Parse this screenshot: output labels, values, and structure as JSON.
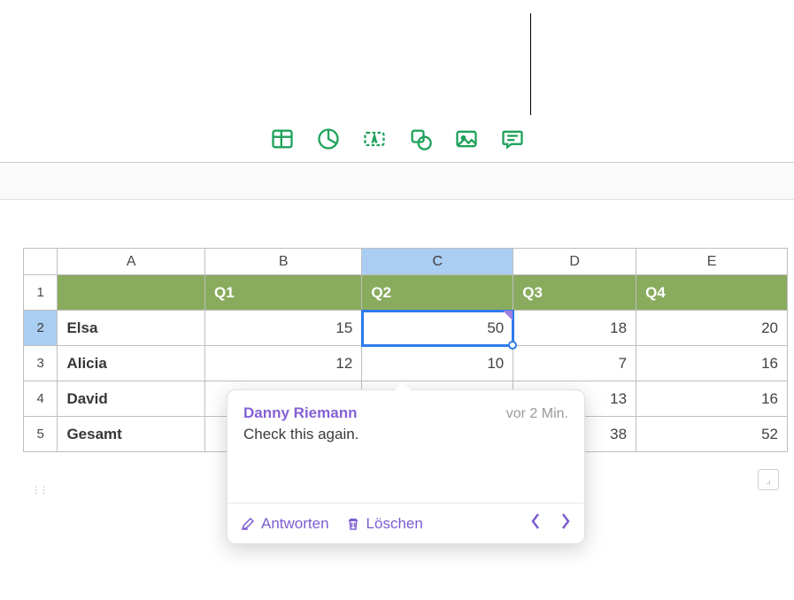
{
  "toolbar": {
    "icons": [
      "table-icon",
      "chart-icon",
      "text-box-icon",
      "shape-icon",
      "image-icon",
      "comment-icon"
    ]
  },
  "columns": [
    "A",
    "B",
    "C",
    "D",
    "E"
  ],
  "selectedColumnIndex": 2,
  "selectedRowIndex": 1,
  "headerRow": {
    "row": "1",
    "cells": [
      "",
      "Q1",
      "Q2",
      "Q3",
      "Q4"
    ]
  },
  "rows": [
    {
      "row": "2",
      "name": "Elsa",
      "vals": [
        "15",
        "50",
        "18",
        "20"
      ]
    },
    {
      "row": "3",
      "name": "Alicia",
      "vals": [
        "12",
        "10",
        "7",
        "16"
      ]
    },
    {
      "row": "4",
      "name": "David",
      "vals": [
        "",
        "",
        "13",
        "16"
      ]
    },
    {
      "row": "5",
      "name": "Gesamt",
      "vals": [
        "",
        "",
        "38",
        "52"
      ]
    }
  ],
  "comment": {
    "author": "Danny Riemann",
    "time": "vor 2 Min.",
    "text": "Check this again.",
    "reply": "Antworten",
    "delete": "Löschen"
  }
}
